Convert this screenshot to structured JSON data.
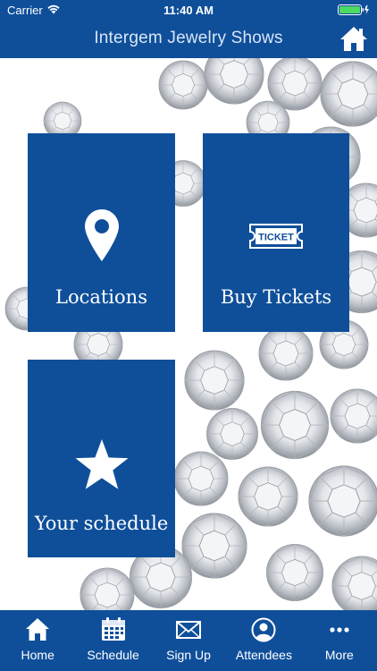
{
  "status_bar": {
    "carrier": "Carrier",
    "time": "11:40 AM",
    "battery_color": "#4cd964"
  },
  "header": {
    "title": "Intergem Jewelry Shows",
    "icon": "home-icon"
  },
  "colors": {
    "brand_blue": "#0f4f9a"
  },
  "tiles": [
    {
      "label": "Locations",
      "icon": "map-pin-icon"
    },
    {
      "label": "Buy Tickets",
      "icon": "ticket-icon",
      "icon_text": "TICKET"
    },
    {
      "label": "Your schedule",
      "icon": "star-icon"
    }
  ],
  "tabbar": {
    "items": [
      {
        "label": "Home",
        "icon": "home-icon"
      },
      {
        "label": "Schedule",
        "icon": "calendar-icon"
      },
      {
        "label": "Sign Up",
        "icon": "envelope-icon"
      },
      {
        "label": "Attendees",
        "icon": "person-icon"
      },
      {
        "label": "More",
        "icon": "more-icon"
      }
    ]
  }
}
